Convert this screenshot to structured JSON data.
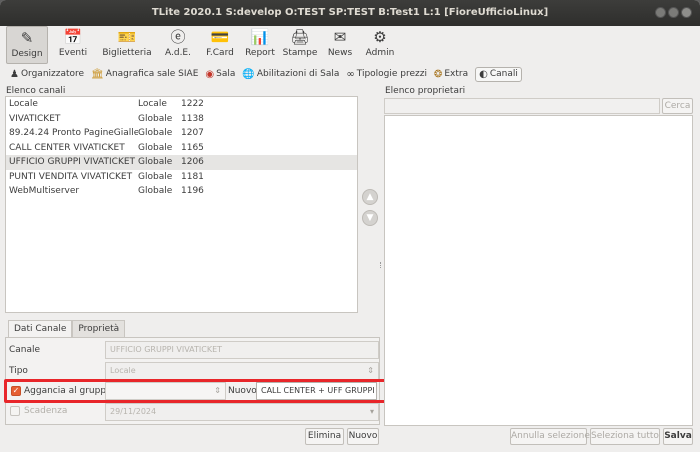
{
  "window": {
    "title": "TLite 2020.1 S:develop O:TEST SP:TEST B:Test1 L:1 [FioreUfficioLinux]"
  },
  "toolbar": [
    {
      "label": "Design",
      "icon": "design-icon"
    },
    {
      "label": "Eventi",
      "icon": "calendar-icon"
    },
    {
      "label": "Biglietteria",
      "icon": "ticket-icon"
    },
    {
      "label": "A.d.E.",
      "icon": "ade-icon"
    },
    {
      "label": "F.Card",
      "icon": "card-icon"
    },
    {
      "label": "Report",
      "icon": "report-icon"
    },
    {
      "label": "Stampe",
      "icon": "printer-icon"
    },
    {
      "label": "News",
      "icon": "mail-icon"
    },
    {
      "label": "Admin",
      "icon": "admin-icon"
    }
  ],
  "subtoolbar": [
    {
      "label": "Organizzatore",
      "icon": "person-icon"
    },
    {
      "label": "Anagrafica sale SIAE",
      "icon": "building-icon"
    },
    {
      "label": "Sala",
      "icon": "sala-icon"
    },
    {
      "label": "Abilitazioni di Sala",
      "icon": "globe-icon"
    },
    {
      "label": "Tipologie prezzi",
      "icon": "glasses-icon"
    },
    {
      "label": "Extra",
      "icon": "extra-icon"
    },
    {
      "label": "Canali",
      "icon": "channel-icon"
    }
  ],
  "left": {
    "list_title": "Elenco canali",
    "rows": [
      {
        "name": "Locale",
        "type": "Locale",
        "code": "1222"
      },
      {
        "name": "VIVATICKET",
        "type": "Globale",
        "code": "1138"
      },
      {
        "name": "89.24.24 Pronto PagineGialle",
        "type": "Globale",
        "code": "1207"
      },
      {
        "name": "CALL CENTER VIVATICKET",
        "type": "Globale",
        "code": "1165"
      },
      {
        "name": "UFFICIO GRUPPI VIVATICKET",
        "type": "Globale",
        "code": "1206"
      },
      {
        "name": "PUNTI VENDITA VIVATICKET",
        "type": "Globale",
        "code": "1181"
      },
      {
        "name": "WebMultiserver",
        "type": "Globale",
        "code": "1196"
      }
    ],
    "tabs": [
      "Dati Canale",
      "Proprietà"
    ],
    "form": {
      "canale_label": "Canale",
      "canale_value": "UFFICIO GRUPPI VIVATICKET",
      "tipo_label": "Tipo",
      "tipo_value": "Locale",
      "aggancia_label": "Aggancia al gruppo",
      "nuovo_label": "Nuovo",
      "nuovo_value": "CALL CENTER + UFF GRUPPI",
      "scadenza_label": "Scadenza",
      "scadenza_value": "29/11/2024"
    },
    "buttons": {
      "elimina": "Elimina",
      "nuovo": "Nuovo"
    }
  },
  "right": {
    "list_title": "Elenco proprietari",
    "search_button": "Cerca",
    "buttons": {
      "annulla": "Annulla selezione",
      "seleziona": "Seleziona tutto",
      "salva": "Salva"
    }
  },
  "colors": {
    "highlight": "#e8262a",
    "checkbox_checked": "#e65f32"
  }
}
